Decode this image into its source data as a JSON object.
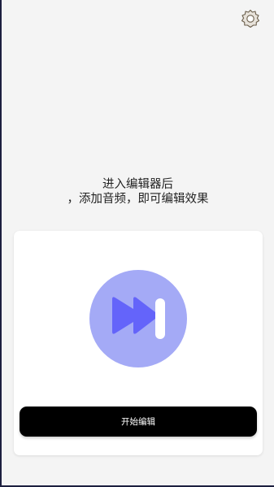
{
  "header": {
    "settings_icon": "gear-icon"
  },
  "main": {
    "hint_text": "进入编辑器后\n，添加音频，即可编辑效果"
  },
  "card": {
    "media_icon": "skip-forward-icon",
    "start_label": "开始编辑"
  },
  "colors": {
    "background": "#f4f4f4",
    "card": "#ffffff",
    "icon_circle": "#a4aaf6",
    "icon_glyph": "#6464fa",
    "button": "#000000",
    "button_text": "#ffffff"
  }
}
